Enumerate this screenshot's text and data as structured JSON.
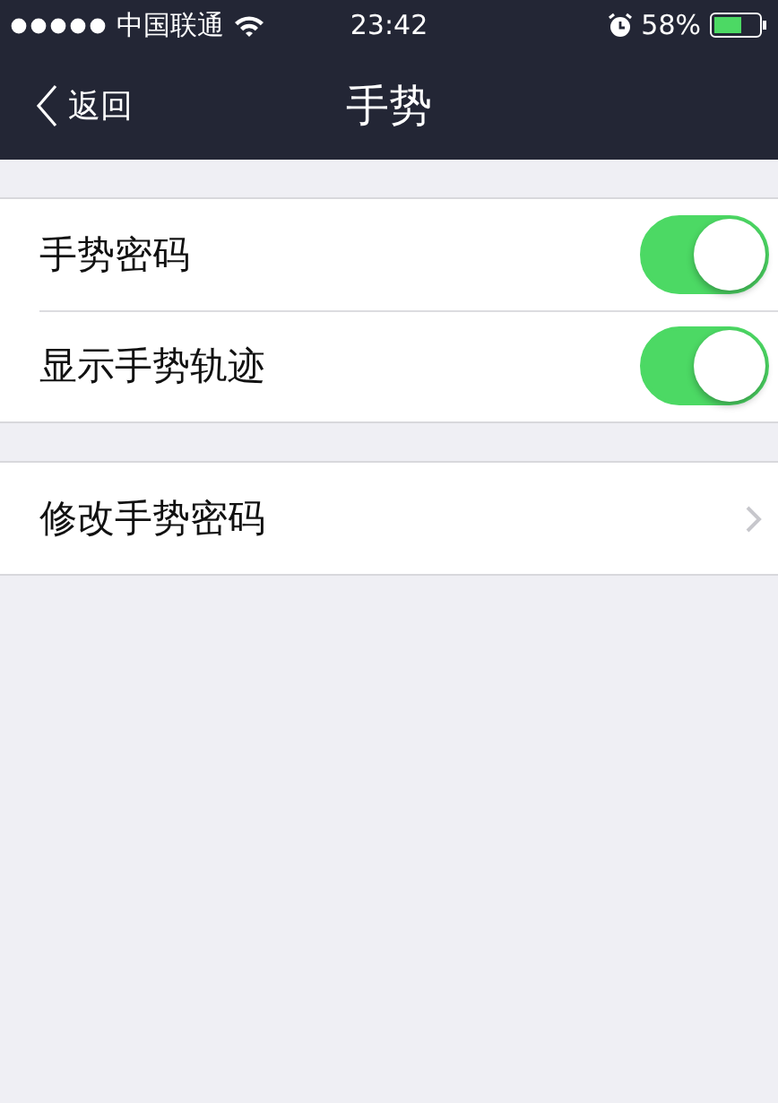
{
  "status_bar": {
    "carrier": "中国联通",
    "time": "23:42",
    "battery": "58%"
  },
  "nav": {
    "back": "返回",
    "title": "手势"
  },
  "groups": [
    {
      "rows": [
        {
          "kind": "toggle",
          "label": "手势密码",
          "on": true
        },
        {
          "kind": "toggle",
          "label": "显示手势轨迹",
          "on": true
        }
      ]
    },
    {
      "rows": [
        {
          "kind": "link",
          "label": "修改手势密码"
        }
      ]
    }
  ]
}
